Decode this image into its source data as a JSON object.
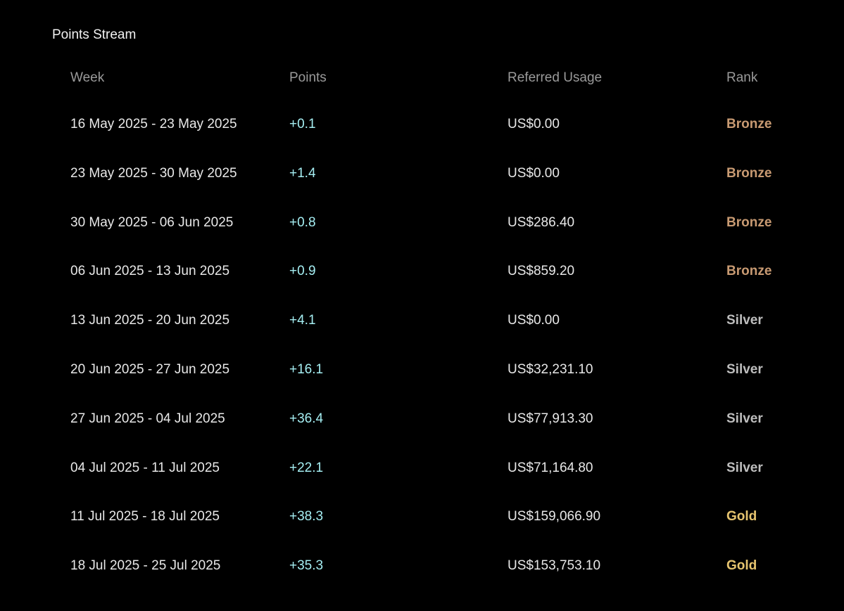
{
  "panel": {
    "title": "Points Stream"
  },
  "table": {
    "columns": {
      "week": "Week",
      "points": "Points",
      "usage": "Referred Usage",
      "rank": "Rank"
    },
    "rows": [
      {
        "week": "16 May 2025 - 23 May 2025",
        "points": "+0.1",
        "usage": "US$0.00",
        "rank": "Bronze",
        "rank_color": "#c89a72"
      },
      {
        "week": "23 May 2025 - 30 May 2025",
        "points": "+1.4",
        "usage": "US$0.00",
        "rank": "Bronze",
        "rank_color": "#c89a72"
      },
      {
        "week": "30 May 2025 - 06 Jun 2025",
        "points": "+0.8",
        "usage": "US$286.40",
        "rank": "Bronze",
        "rank_color": "#c89a72"
      },
      {
        "week": "06 Jun 2025 - 13 Jun 2025",
        "points": "+0.9",
        "usage": "US$859.20",
        "rank": "Bronze",
        "rank_color": "#c89a72"
      },
      {
        "week": "13 Jun 2025 - 20 Jun 2025",
        "points": "+4.1",
        "usage": "US$0.00",
        "rank": "Silver",
        "rank_color": "#bdbdbd"
      },
      {
        "week": "20 Jun 2025 - 27 Jun 2025",
        "points": "+16.1",
        "usage": "US$32,231.10",
        "rank": "Silver",
        "rank_color": "#bdbdbd"
      },
      {
        "week": "27 Jun 2025 - 04 Jul 2025",
        "points": "+36.4",
        "usage": "US$77,913.30",
        "rank": "Silver",
        "rank_color": "#bdbdbd"
      },
      {
        "week": "04 Jul 2025 - 11 Jul 2025",
        "points": "+22.1",
        "usage": "US$71,164.80",
        "rank": "Silver",
        "rank_color": "#bdbdbd"
      },
      {
        "week": "11 Jul 2025 - 18 Jul 2025",
        "points": "+38.3",
        "usage": "US$159,066.90",
        "rank": "Gold",
        "rank_color": "#e6c46f"
      },
      {
        "week": "18 Jul 2025 - 25 Jul 2025",
        "points": "+35.3",
        "usage": "US$153,753.10",
        "rank": "Gold",
        "rank_color": "#e6c46f"
      }
    ]
  },
  "colors": {
    "background": "#000000",
    "points_accent": "#a5eef2",
    "bronze": "#c89a72",
    "silver": "#bdbdbd",
    "gold": "#e6c46f"
  }
}
